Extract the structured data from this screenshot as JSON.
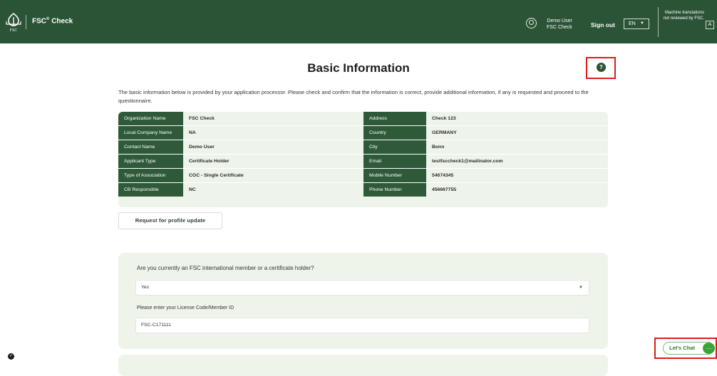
{
  "header": {
    "logo_text": "FSC",
    "app_name": "FSC",
    "app_name_suffix": "Check",
    "registered": "®",
    "user_name": "Demo User",
    "user_org": "FSC Check",
    "sign_out": "Sign out",
    "language": "EN",
    "mt_note": "Machine translations not reviewed by FSC."
  },
  "page": {
    "title": "Basic Information",
    "help": "?",
    "intro": "The basic information below is provided by your application processor. Please check and confirm that the information is correct, provide additional information, if any is requested and proceed to the questionnaire."
  },
  "info_left": [
    {
      "label": "Organization Name",
      "value": "FSC Check"
    },
    {
      "label": "Local Company Name",
      "value": "NA"
    },
    {
      "label": "Contact Name",
      "value": "Demo User"
    },
    {
      "label": "Applicant Type",
      "value": "Certificate Holder"
    },
    {
      "label": "Type of Association",
      "value": "COC - Single Certificate"
    },
    {
      "label": "CB Responsible",
      "value": "NC"
    }
  ],
  "info_right": [
    {
      "label": "Address",
      "value": "Check 123"
    },
    {
      "label": "Country",
      "value": "GERMANY"
    },
    {
      "label": "City",
      "value": "Bonn"
    },
    {
      "label": "Email",
      "value": "testfsccheck1@mailinator.com"
    },
    {
      "label": "Mobile Number",
      "value": "54674345"
    },
    {
      "label": "Phone Number",
      "value": "456667755"
    }
  ],
  "request_button": "Request for profile update",
  "question": {
    "text": "Are you currently an FSC international member or a certificate holder?",
    "selected": "Yes",
    "license_label": "Please enter your License Code/Member ID",
    "license_value": "FSC-C171111"
  },
  "chat": {
    "label": "Let's Chat",
    "icon": "chat-bubble-icon"
  },
  "colors": {
    "header_bg": "#2b5336",
    "label_bg": "#2e5a3a",
    "panel_bg": "#eef4ea",
    "highlight": "#e01b1b",
    "chat_green": "#3aa33a"
  }
}
